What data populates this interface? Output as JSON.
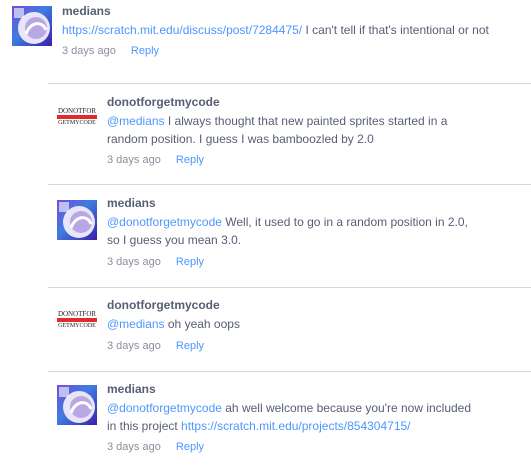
{
  "comments": [
    {
      "username": "medians",
      "link": "https://scratch.mit.edu/discuss/post/7284475/",
      "text": "I can't tell if that's intentional or not",
      "time": "3 days ago",
      "reply": "Reply"
    },
    {
      "username": "donotforgetmycode",
      "avatar_text_top": "DONOTFOR",
      "avatar_text_bottom": "GETMYCODE",
      "mention": "@medians",
      "text_line1": " I always thought that new painted sprites started in a",
      "text_line2": "random position. I guess I was bamboozled by 2.0",
      "time": "3 days ago",
      "reply": "Reply"
    },
    {
      "username": "medians",
      "mention": "@donotforgetmycode",
      "text_line1": " Well, it used to go in a random position in 2.0,",
      "text_line2": "so I guess you mean 3.0.",
      "time": "3 days ago",
      "reply": "Reply"
    },
    {
      "username": "donotforgetmycode",
      "avatar_text_top": "DONOTFOR",
      "avatar_text_bottom": "GETMYCODE",
      "mention": "@medians",
      "text": " oh yeah oops",
      "time": "3 days ago",
      "reply": "Reply"
    },
    {
      "username": "medians",
      "mention": "@donotforgetmycode",
      "text_line1": " ah well welcome because you're now included",
      "text_line2": "in this project ",
      "link": "https://scratch.mit.edu/projects/854304715/",
      "time": "3 days ago",
      "reply": "Reply"
    }
  ]
}
